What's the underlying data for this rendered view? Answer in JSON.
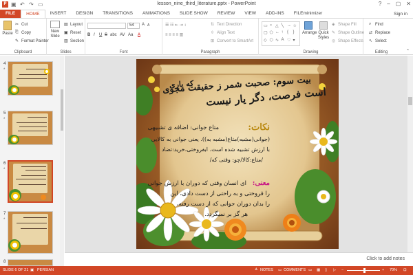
{
  "window": {
    "title": "lesson_nine_third_literature.pptx - PowerPoint",
    "help": "?",
    "minimize": "–",
    "restore": "▢",
    "close": "✕"
  },
  "quick_access": [
    "save-icon",
    "undo-icon",
    "redo-icon",
    "start-icon"
  ],
  "tabs": [
    {
      "label": "FILE"
    },
    {
      "label": "HOME"
    },
    {
      "label": "INSERT"
    },
    {
      "label": "DESIGN"
    },
    {
      "label": "TRANSITIONS"
    },
    {
      "label": "ANIMATIONS"
    },
    {
      "label": "SLIDE SHOW"
    },
    {
      "label": "REVIEW"
    },
    {
      "label": "VIEW"
    },
    {
      "label": "ADD-INS"
    },
    {
      "label": "FILEminimizer"
    }
  ],
  "account": {
    "signin": "Sign in"
  },
  "ribbon": {
    "clipboard": {
      "label": "Clipboard",
      "paste": "Paste",
      "cut": "Cut",
      "copy": "Copy",
      "format_painter": "Format Painter"
    },
    "slides": {
      "label": "Slides",
      "new_slide": "New Slide",
      "layout": "Layout",
      "reset": "Reset",
      "section": "Section"
    },
    "font": {
      "label": "Font",
      "font_name": "",
      "font_size": "54",
      "bold": "B",
      "italic": "I",
      "underline": "U",
      "strike": "S",
      "shadow": "abc",
      "spacing": "AV",
      "case": "Aa",
      "color": "A",
      "grow": "A",
      "shrink": "A"
    },
    "paragraph": {
      "label": "Paragraph",
      "text_direction": "Text Direction",
      "align_text": "Align Text",
      "smartart": "Convert to SmartArt"
    },
    "drawing": {
      "label": "Drawing",
      "arrange": "Arrange",
      "quick_styles": "Quick Styles",
      "shape_fill": "Shape Fill",
      "shape_outline": "Shape Outline",
      "shape_effects": "Shape Effects"
    },
    "editing": {
      "label": "Editing",
      "find": "Find",
      "replace": "Replace",
      "select": "Select"
    }
  },
  "thumbnails": [
    {
      "number": "4",
      "star": "*"
    },
    {
      "number": "5",
      "star": "*"
    },
    {
      "number": "6",
      "star": "*"
    },
    {
      "number": "7",
      "star": "*"
    },
    {
      "number": "8",
      "star": ""
    }
  ],
  "slide": {
    "heading_line1": "بیت سوم: صحبت شمر ز حقیقت مجوی",
    "heading_line2": "است فرصت، دگر یار نیست",
    "heading_right": "که یاری",
    "nokat_label": "نکات:",
    "nokat_text1": "متاع جوانی: اضافه ی تشبیهی",
    "nokat_text2": "(جوانی(مشبه)متاع(مشبه به)). یعنی جوانی به کالایی",
    "nokat_text3": "با ارزش تشبیه شده است. ابفروختی،خرید:تضاد",
    "nokat_text4": "/متاع:کالا/چو: وقتی که/",
    "mani_label": "معنی:",
    "mani_text1": "ای انسان وقتی که دوران با ارزش جوانی",
    "mani_text2": "را فروختی و به راحتی از دست دادی، این",
    "mani_text3": "را بدان دوران جوانی که از دست رفته،",
    "mani_text4": "هر گز بر نمیگردد."
  },
  "notes": {
    "placeholder": "Click to add notes"
  },
  "status": {
    "slide_info": "SLIDE 6 OF 21",
    "language": "PERSIAN",
    "notes": "NOTES",
    "comments": "COMMENTS",
    "zoom": "70%"
  },
  "colors": {
    "accent": "#d24726",
    "slide_frame": "#8c4a1f",
    "parchment": "#ead6a8",
    "nokat_color": "#b8860b",
    "mani_color": "#c71585"
  }
}
